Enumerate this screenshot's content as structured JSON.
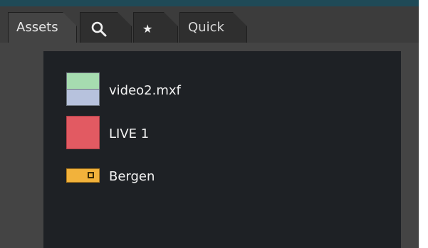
{
  "tabs": [
    {
      "label": "Assets",
      "icon": null,
      "active": true
    },
    {
      "label": "",
      "icon": "search-icon",
      "active": false
    },
    {
      "label": "",
      "icon": "star-icon",
      "active": false
    },
    {
      "label": "Quick",
      "icon": null,
      "active": false
    }
  ],
  "assets": [
    {
      "name": "video2.mxf",
      "type": "video-clip",
      "colors": {
        "top": "#a6dcb0",
        "bottom": "#b7c2dd"
      }
    },
    {
      "name": "LIVE 1",
      "type": "live-source",
      "colors": {
        "fill": "#e25a62"
      }
    },
    {
      "name": "Bergen",
      "type": "location",
      "colors": {
        "fill": "#f2b23b"
      }
    }
  ],
  "colors": {
    "accent_strip": "#1f4a57",
    "panel_bg": "#444444",
    "list_bg": "#1e2125"
  }
}
